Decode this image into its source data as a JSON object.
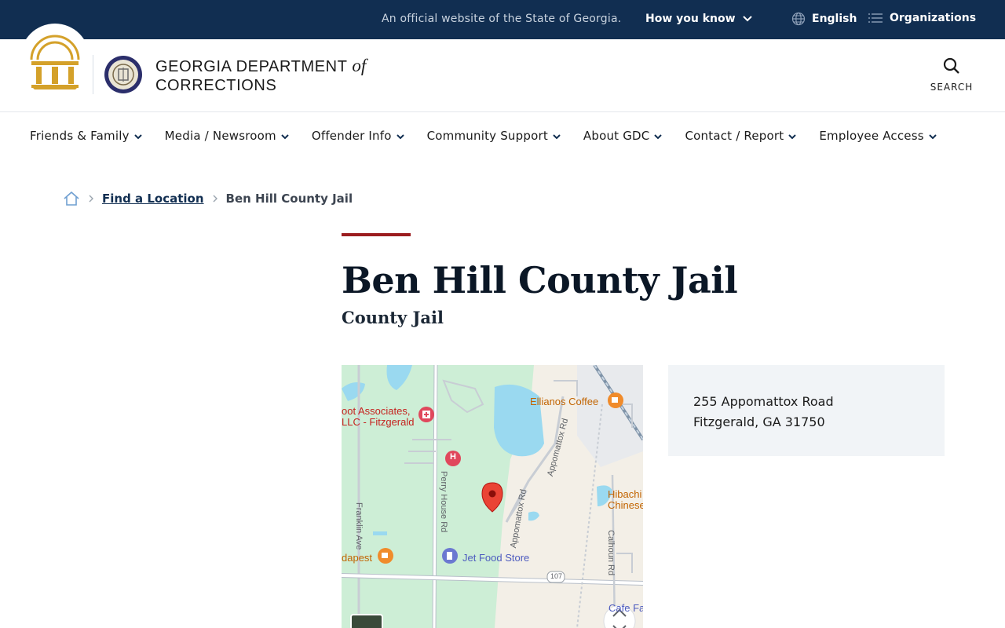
{
  "gov_banner": {
    "official_text": "An official website of the State of Georgia.",
    "how_you_know": "How you know",
    "language": "English",
    "organizations": "Organizations"
  },
  "header": {
    "title_line1": "GEORGIA DEPARTMENT",
    "title_of": "of",
    "title_line2": "CORRECTIONS",
    "search_label": "SEARCH"
  },
  "nav": {
    "items": [
      {
        "label": "Friends & Family"
      },
      {
        "label": "Media / Newsroom"
      },
      {
        "label": "Offender Info"
      },
      {
        "label": "Community Support"
      },
      {
        "label": "About GDC"
      },
      {
        "label": "Contact / Report"
      },
      {
        "label": "Employee Access"
      }
    ]
  },
  "breadcrumb": {
    "link": "Find a Location",
    "current": "Ben Hill County Jail"
  },
  "page": {
    "title": "Ben Hill County Jail",
    "subtitle": "County Jail"
  },
  "map": {
    "labels": {
      "foot_associates_1": "oot Associates,",
      "foot_associates_2": "LLC - Fitzgerald",
      "ellianos": "Ellianos Coffee",
      "hibachi_1": "Hibachi",
      "hibachi_2": "Chinese",
      "budapest": "dapest",
      "jet_food": "Jet Food Store",
      "cafe": "Cafe Fa",
      "perry_house": "Perry House Rd",
      "franklin": "Franklin Ave",
      "appomattox_1": "Appomattox Rd",
      "appomattox_2": "Appomattox Rd",
      "calhoun": "Calhoun Rd",
      "route": "107",
      "hospital": "H"
    }
  },
  "address": {
    "line1": "255 Appomattox Road",
    "line2": "Fitzgerald, GA 31750"
  },
  "colors": {
    "banner": "#112e51",
    "accent_red": "#9b1c1f",
    "gold": "#d4a12a",
    "card_bg": "#f1f4f7"
  }
}
